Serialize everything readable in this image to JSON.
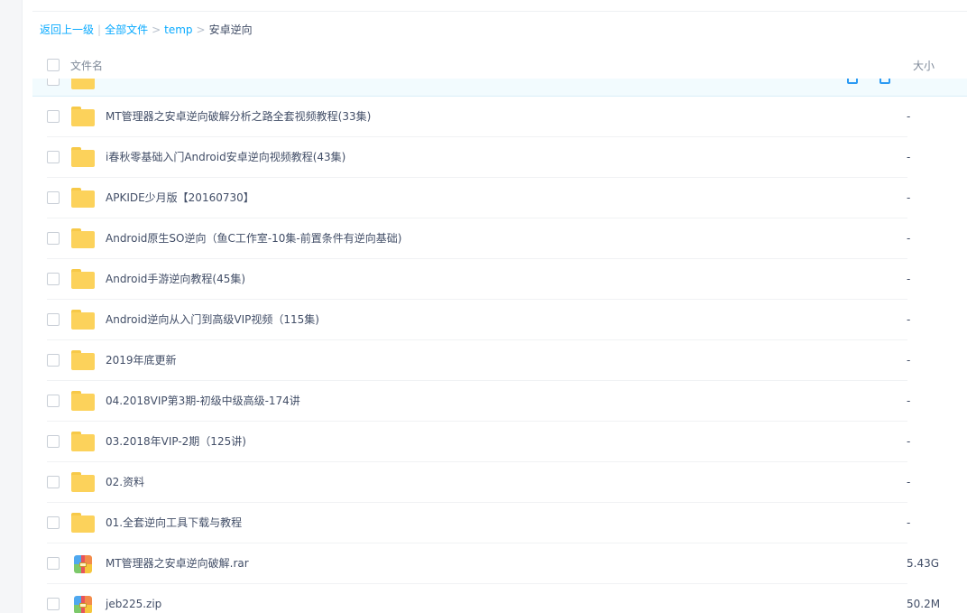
{
  "breadcrumb": {
    "back": "返回上一级",
    "all_files": "全部文件",
    "folder": "temp",
    "current": "安卓逆向",
    "separator": ">",
    "pipe": "|"
  },
  "header": {
    "name_col": "文件名",
    "size_col": "大小"
  },
  "rows": [
    {
      "name": "MT管理器之安卓逆向破解分析之路全套视频教程(33集)",
      "size": "-",
      "type": "folder"
    },
    {
      "name": "i春秋零基础入门Android安卓逆向视频教程(43集)",
      "size": "-",
      "type": "folder"
    },
    {
      "name": "APKIDE少月版【20160730】",
      "size": "-",
      "type": "folder"
    },
    {
      "name": "Android原生SO逆向（鱼C工作室-10集-前置条件有逆向基础)",
      "size": "-",
      "type": "folder"
    },
    {
      "name": "Android手游逆向教程(45集)",
      "size": "-",
      "type": "folder"
    },
    {
      "name": "Android逆向从入门到高级VIP视频（115集)",
      "size": "-",
      "type": "folder"
    },
    {
      "name": "2019年底更新",
      "size": "-",
      "type": "folder"
    },
    {
      "name": "04.2018VIP第3期-初级中级高级-174讲",
      "size": "-",
      "type": "folder"
    },
    {
      "name": "03.2018年VIP-2期（125讲)",
      "size": "-",
      "type": "folder"
    },
    {
      "name": "02.资料",
      "size": "-",
      "type": "folder"
    },
    {
      "name": "01.全套逆向工具下载与教程",
      "size": "-",
      "type": "folder"
    },
    {
      "name": "MT管理器之安卓逆向破解.rar",
      "size": "5.43G",
      "type": "archive"
    },
    {
      "name": "jeb225.zip",
      "size": "50.2M",
      "type": "archive"
    }
  ],
  "colors": {
    "link": "#09aaff",
    "text": "#424e67",
    "folder": "#fcd25b",
    "hover_row": "#f2fbfe"
  }
}
